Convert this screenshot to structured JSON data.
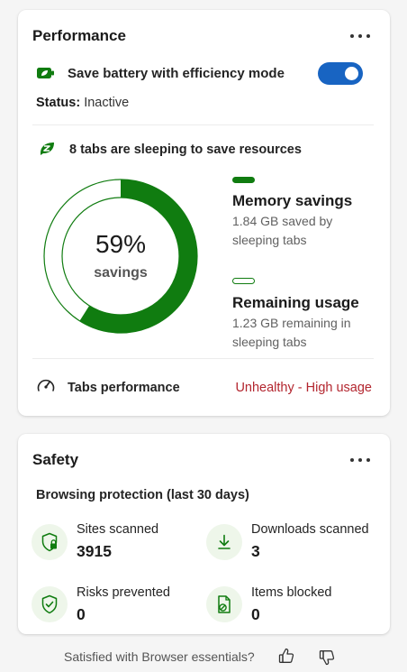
{
  "performance": {
    "title": "Performance",
    "efficiency_label": "Save battery with efficiency mode",
    "efficiency_enabled": true,
    "status_prefix": "Status:",
    "status_value": "Inactive",
    "sleeping_text": "8 tabs are sleeping to save resources",
    "savings_percent_text": "59%",
    "savings_fraction": 0.59,
    "savings_word": "savings",
    "memory_title": "Memory savings",
    "memory_desc_line1": "1.84 GB saved by",
    "memory_desc_line2": "sleeping tabs",
    "remaining_title": "Remaining usage",
    "remaining_desc_line1": "1.23 GB remaining in",
    "remaining_desc_line2": "sleeping tabs",
    "tabs_perf_label": "Tabs performance",
    "tabs_perf_status": "Unhealthy - High usage"
  },
  "safety": {
    "title": "Safety",
    "subtitle": "Browsing protection (last 30 days)",
    "stats": [
      {
        "label": "Sites scanned",
        "value": "3915",
        "icon": "lock-shield-icon"
      },
      {
        "label": "Downloads scanned",
        "value": "3",
        "icon": "download-icon"
      },
      {
        "label": "Risks prevented",
        "value": "0",
        "icon": "shield-check-icon"
      },
      {
        "label": "Items blocked",
        "value": "0",
        "icon": "blocked-document-icon"
      }
    ]
  },
  "feedback": {
    "question": "Satisfied with Browser essentials?"
  },
  "colors": {
    "accent_green": "#107c10",
    "toggle_blue": "#1864c2",
    "warning_red": "#b3262f"
  }
}
